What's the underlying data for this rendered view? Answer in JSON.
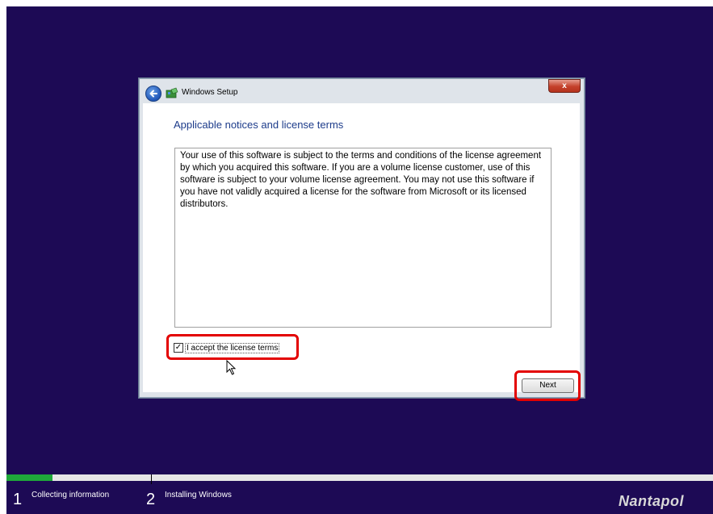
{
  "window": {
    "title": "Windows Setup",
    "close_label": "x"
  },
  "page": {
    "heading": "Applicable notices and license terms",
    "license_text": "Your use of this software is subject to the terms and conditions of the license agreement by which you acquired this software.  If you are a volume license customer, use of this software is subject to your volume license agreement.  You may not use this software if you have not validly acquired a license for the software from Microsoft or its licensed distributors.",
    "accept_label": "I accept the license terms",
    "accept_checked": true,
    "next_label": "Next"
  },
  "progress": {
    "fraction": 0.065,
    "steps": [
      {
        "number": "1",
        "label": "Collecting information"
      },
      {
        "number": "2",
        "label": "Installing Windows"
      }
    ]
  },
  "watermark": "Nantapol",
  "colors": {
    "background": "#1d0a55",
    "heading": "#1c3b8a",
    "highlight": "#e30000",
    "progress_fill": "#1fa83a"
  },
  "icons": [
    "back-arrow-icon",
    "windows-setup-icon",
    "close-icon",
    "checkmark-icon",
    "mouse-cursor-icon"
  ]
}
